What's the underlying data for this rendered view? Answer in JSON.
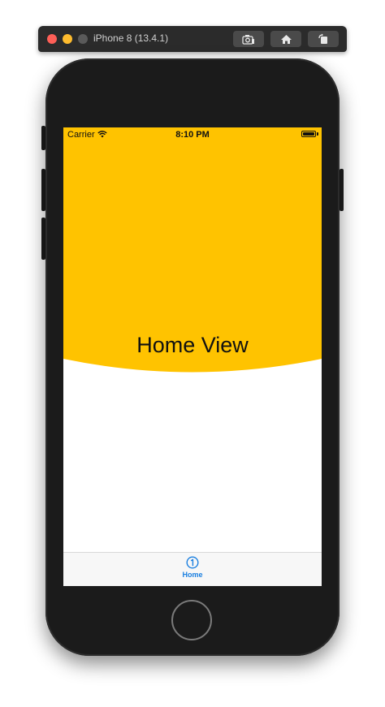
{
  "window": {
    "title": "iPhone 8 (13.4.1)",
    "toolbar": {
      "screenshot_icon": "camera-icon",
      "home_icon": "home-icon",
      "rotate_icon": "rotate-icon"
    }
  },
  "status_bar": {
    "carrier": "Carrier",
    "time": "8:10 PM",
    "wifi_icon": "wifi-icon",
    "battery_icon": "battery-icon"
  },
  "hero": {
    "title": "Home View",
    "background_color": "#FFC300"
  },
  "tab_bar": {
    "items": [
      {
        "label": "Home",
        "icon": "number-1-circle-icon",
        "selected": true
      }
    ],
    "accent_color": "#1A7FE0"
  }
}
